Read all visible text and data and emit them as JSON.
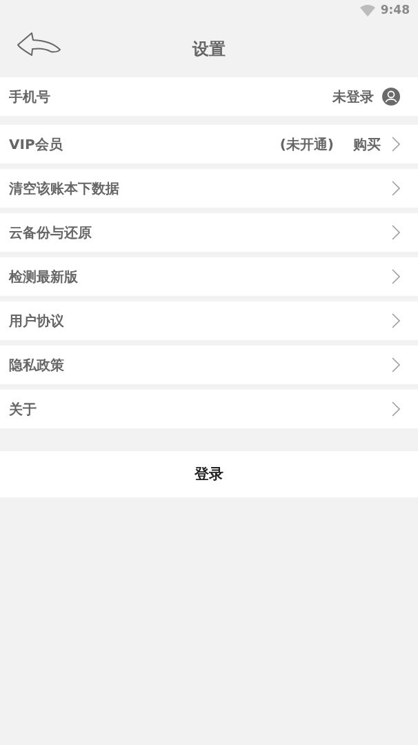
{
  "status_bar": {
    "time": "9:48"
  },
  "header": {
    "title": "设置"
  },
  "items": [
    {
      "kind": "account",
      "label": "手机号",
      "value": "未登录"
    },
    {
      "kind": "vip",
      "label": "VIP会员",
      "status": "(未开通)",
      "action": "购买"
    },
    {
      "kind": "link",
      "label": "清空该账本下数据"
    },
    {
      "kind": "link",
      "label": "云备份与还原"
    },
    {
      "kind": "link",
      "label": "检测最新版"
    },
    {
      "kind": "link",
      "label": "用户协议"
    },
    {
      "kind": "link",
      "label": "隐私政策"
    },
    {
      "kind": "link",
      "label": "关于"
    }
  ],
  "login_button": "登录"
}
